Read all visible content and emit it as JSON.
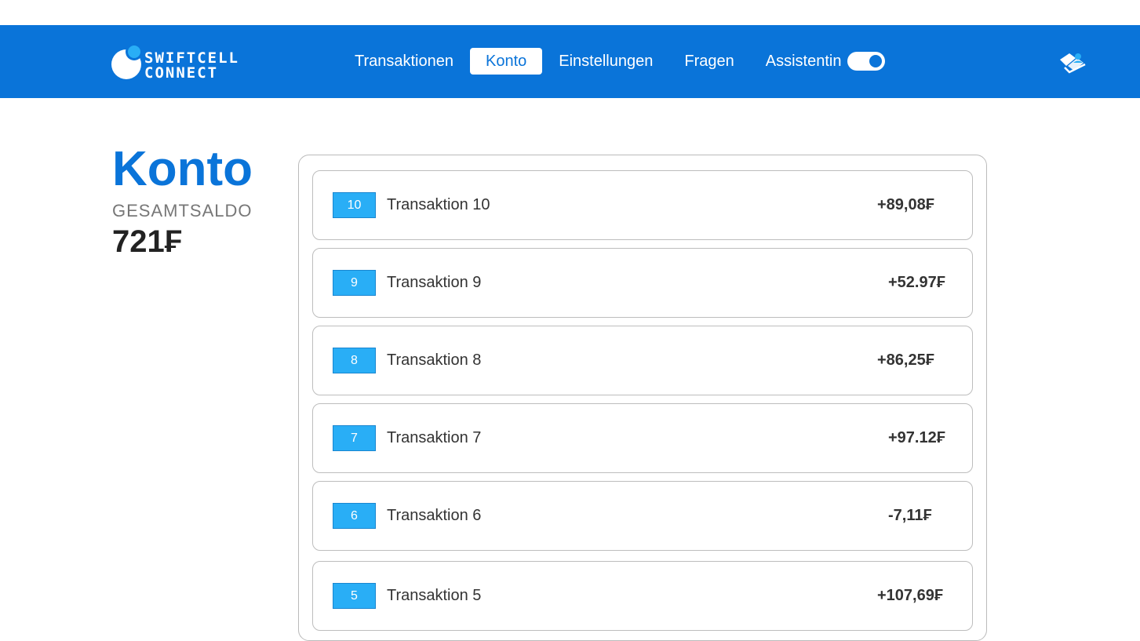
{
  "header": {
    "logo_line1": "SWIFTCELL",
    "logo_line2": "CONNECT",
    "nav": [
      {
        "label": "Transaktionen",
        "active": false
      },
      {
        "label": "Konto",
        "active": true
      },
      {
        "label": "Einstellungen",
        "active": false
      },
      {
        "label": "Fragen",
        "active": false
      },
      {
        "label": "Assistentin",
        "active": false
      }
    ],
    "assistant_toggle_on": true
  },
  "page": {
    "title": "Konto",
    "balance_label": "GESAMTSALDO",
    "balance_value": "721₣"
  },
  "colors": {
    "brand": "#0a74d9",
    "badge": "#29aef6"
  },
  "transactions": [
    {
      "id": "10",
      "name": "Transaktion 10",
      "amount": "+89,08₣"
    },
    {
      "id": "9",
      "name": "Transaktion 9",
      "amount": "+52.97₣"
    },
    {
      "id": "8",
      "name": "Transaktion 8",
      "amount": "+86,25₣"
    },
    {
      "id": "7",
      "name": "Transaktion 7",
      "amount": "+97.12₣"
    },
    {
      "id": "6",
      "name": "Transaktion 6",
      "amount": "-7,11₣"
    },
    {
      "id": "5",
      "name": "Transaktion 5",
      "amount": "+107,69₣"
    }
  ]
}
